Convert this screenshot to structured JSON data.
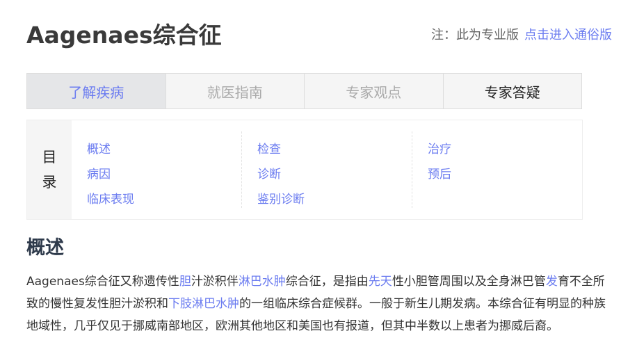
{
  "header": {
    "title": "Aagenaes综合征",
    "note": "注：此为专业版",
    "popular_link": "点击进入通俗版"
  },
  "tabs": [
    "了解疾病",
    "就医指南",
    "专家观点",
    "专家答疑"
  ],
  "toc": {
    "label_1": "目",
    "label_2": "录",
    "columns": [
      [
        "概述",
        "病因",
        "临床表现"
      ],
      [
        "检查",
        "诊断",
        "鉴别诊断"
      ],
      [
        "治疗",
        "预后"
      ]
    ]
  },
  "section": {
    "heading": "概述",
    "segments": [
      "Aagenaes综合征又称遗传性",
      "胆",
      "汁淤积伴",
      "淋巴水肿",
      "综合征，是指由",
      "先天",
      "性小胆管周围以及全身淋巴管",
      "发",
      "育不全所致的慢性复发性胆汁淤积和",
      "下肢淋巴水肿",
      "的一组临床综合症候群。一般于新生儿期发病。本综合征有明显的种族地域性，几乎仅见于挪威南部地区，欧洲其他地区和美国也有报道，但其中半数以上患者为挪威后裔。"
    ]
  },
  "colors": {
    "accent": "#6b7cf0",
    "text": "#333333"
  }
}
